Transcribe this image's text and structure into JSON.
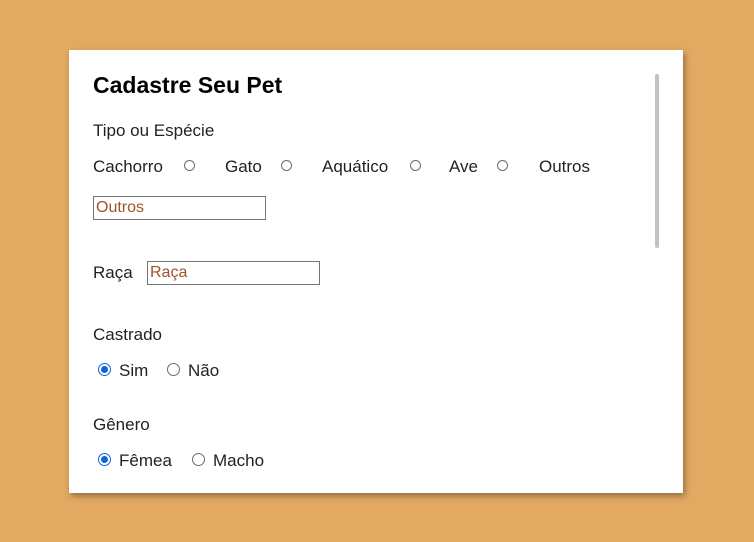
{
  "form": {
    "title": "Cadastre Seu Pet",
    "species": {
      "label": "Tipo ou Espécie",
      "options": [
        "Cachorro",
        "Gato",
        "Aquático",
        "Ave",
        "Outros"
      ],
      "other_input": {
        "value": "Outros",
        "placeholder": "Outros"
      }
    },
    "breed": {
      "label": "Raça",
      "input": {
        "value": "Raça",
        "placeholder": "Raça"
      }
    },
    "neutered": {
      "label": "Castrado",
      "options": [
        "Sim",
        "Não"
      ],
      "selected": "Sim"
    },
    "gender": {
      "label": "Gênero",
      "options": [
        "Fêmea",
        "Macho"
      ],
      "selected": "Fêmea"
    }
  },
  "colors": {
    "background": "#e2a962",
    "card": "#ffffff",
    "radio_checked": "#0a66d8",
    "input_text": "#a0522d"
  }
}
